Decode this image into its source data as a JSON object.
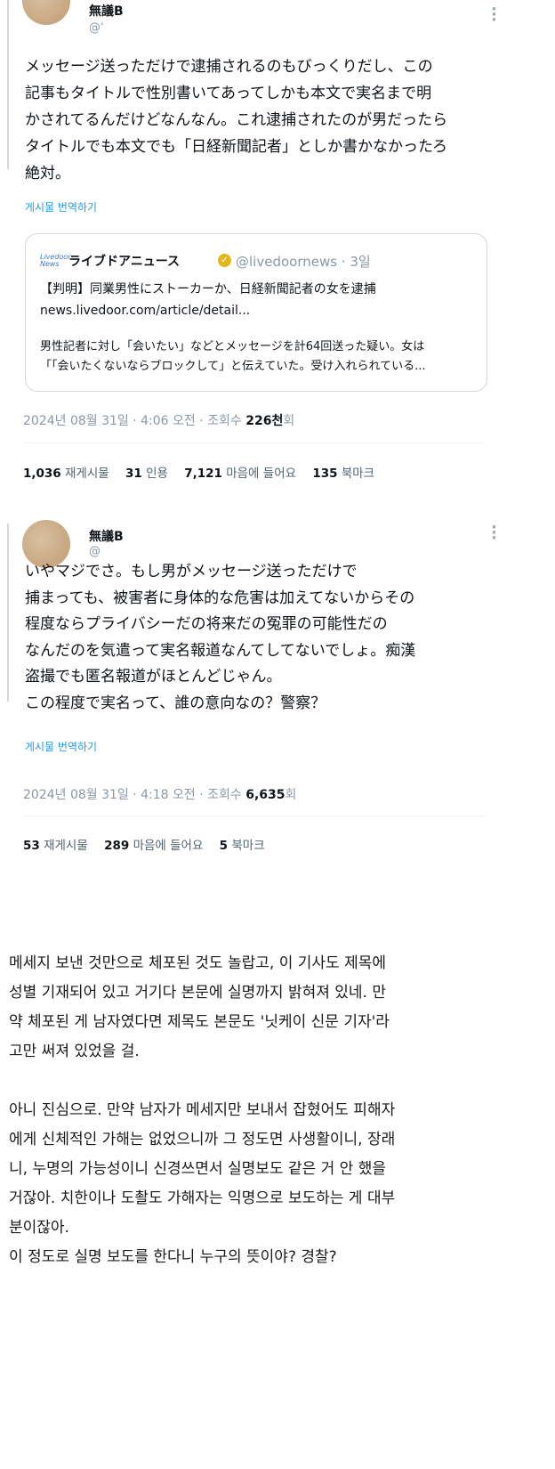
{
  "tweets": [
    {
      "author_name": "無議B",
      "author_handle": "@'",
      "body_lines": [
        "メッセージ送っただけで逮捕されるのもびっくりだし、この",
        "記事もタイトルで性別書いてあってしかも本文で実名まで明",
        "かされてるんだけどなんなん。これ逮捕されたのが男だったら",
        "タイトルでも本文でも「日経新聞記者」としか書かなかったろ",
        "絶対。"
      ],
      "translate_label": "게시물 번역하기",
      "quote": {
        "logo_text": "Livedoor News",
        "name": "ライブドアニュース",
        "handle_time": "@livedoornews · 3일",
        "title": "【判明】同業男性にストーカーか、日経新聞記者の女を逮捕",
        "link": "news.livedoor.com/article/detail...",
        "desc_line1": "男性記者に対し「会いたい」などとメッセージを計64回送った疑い。女は",
        "desc_line2": "「「会いたくないならブロックして」と伝えていた。受け入れられている..."
      },
      "meta_prefix": "2024년 08월 31일 · 4:06 오전 · 조회수 ",
      "views_number": "226천",
      "views_suffix": "회",
      "stats": [
        {
          "num": "1,036",
          "label": "재게시물"
        },
        {
          "num": "31",
          "label": "인용"
        },
        {
          "num": "7,121",
          "label": "마음에 들어요"
        },
        {
          "num": "135",
          "label": "북마크"
        }
      ]
    },
    {
      "author_name": "無議B",
      "author_handle": "@",
      "body_lines": [
        "いやマジでさ。もし男がメッセージ送っただけで",
        "捕まっても、被害者に身体的な危害は加えてないからその",
        "程度ならプライバシーだの将来だの冤罪の可能性だの",
        "なんだのを気遣って実名報道なんてしてないでしょ。痴漢",
        "盗撮でも匿名報道がほとんどじゃん。",
        "この程度で実名って、誰の意向なの？警察？"
      ],
      "translate_label": "게시물 번역하기",
      "meta_prefix": "2024년 08월 31일 · 4:18 오전 · 조회수 ",
      "views_number": "6,635",
      "views_suffix": "회",
      "stats": [
        {
          "num": "53",
          "label": "재게시물"
        },
        {
          "num": "289",
          "label": "마음에 들어요"
        },
        {
          "num": "5",
          "label": "북마크"
        }
      ]
    }
  ],
  "translation": {
    "para1": [
      "메세지 보낸 것만으로 체포된 것도 놀랍고, 이 기사도 제목에",
      "성별 기재되어 있고 거기다 본문에 실명까지 밝혀져 있네. 만",
      "약 체포된 게 남자였다면 제목도 본문도 '닛케이 신문 기자'라",
      "고만 써져 있었을 걸."
    ],
    "para2": [
      "아니 진심으로. 만약 남자가 메세지만 보내서 잡혔어도 피해자",
      "에게 신체적인 가해는 없었으니까 그 정도면 사생활이니, 장래",
      "니, 누명의 가능성이니 신경쓰면서 실명보도 같은 거 안 했을",
      "거잖아. 치한이나 도촬도 가해자는 익명으로 보도하는 게 대부",
      "분이잖아.",
      "이 정도로 실명 보도를 한다니 누구의 뜻이야? 경찰?"
    ]
  },
  "icons": [
    "more-vertical-icon",
    "verified-badge-icon",
    "news-logo-icon"
  ]
}
